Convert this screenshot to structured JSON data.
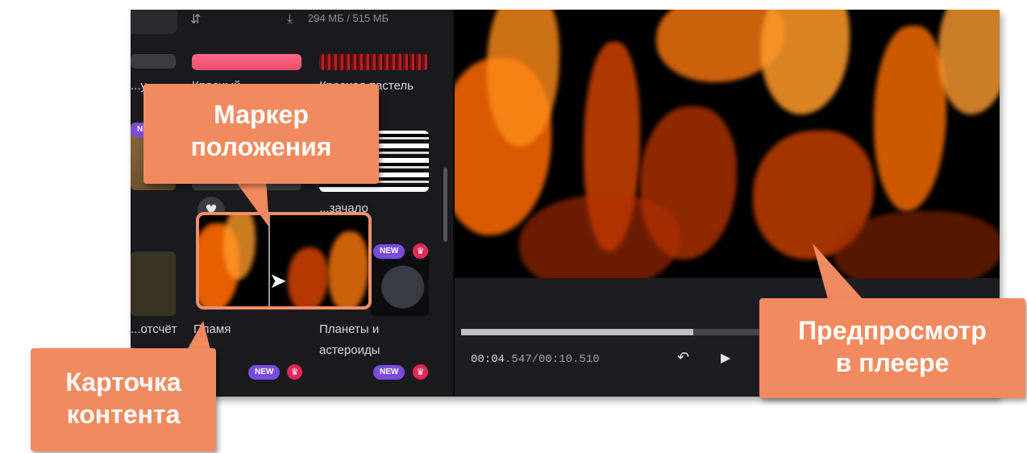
{
  "library": {
    "storage": "294 МБ / 515 МБ",
    "items": [
      {
        "label": "Красный..."
      },
      {
        "label": "Красная пастель"
      },
      {
        "label": "...у - ..."
      },
      {
        "label": "...зачало"
      },
      {
        "label": "...отсчёт"
      },
      {
        "label": "Пламя"
      },
      {
        "label": "Планеты и"
      },
      {
        "label": "астероиды"
      }
    ],
    "badge_new": "NEW",
    "crown_icon": "♛"
  },
  "player": {
    "time_current": "00:04",
    "time_ms": ".547",
    "time_total": "/00:10.510",
    "progress_percent": 45
  },
  "callouts": {
    "marker_line1": "Маркер",
    "marker_line2": "положения",
    "card_line1": "Карточка",
    "card_line2": "контента",
    "preview_line1": "Предпросмотр",
    "preview_line2": "в плеере"
  },
  "colors": {
    "callout": "#f28a60",
    "new_badge": "#7a4be0",
    "premium_badge": "#e8275a"
  }
}
